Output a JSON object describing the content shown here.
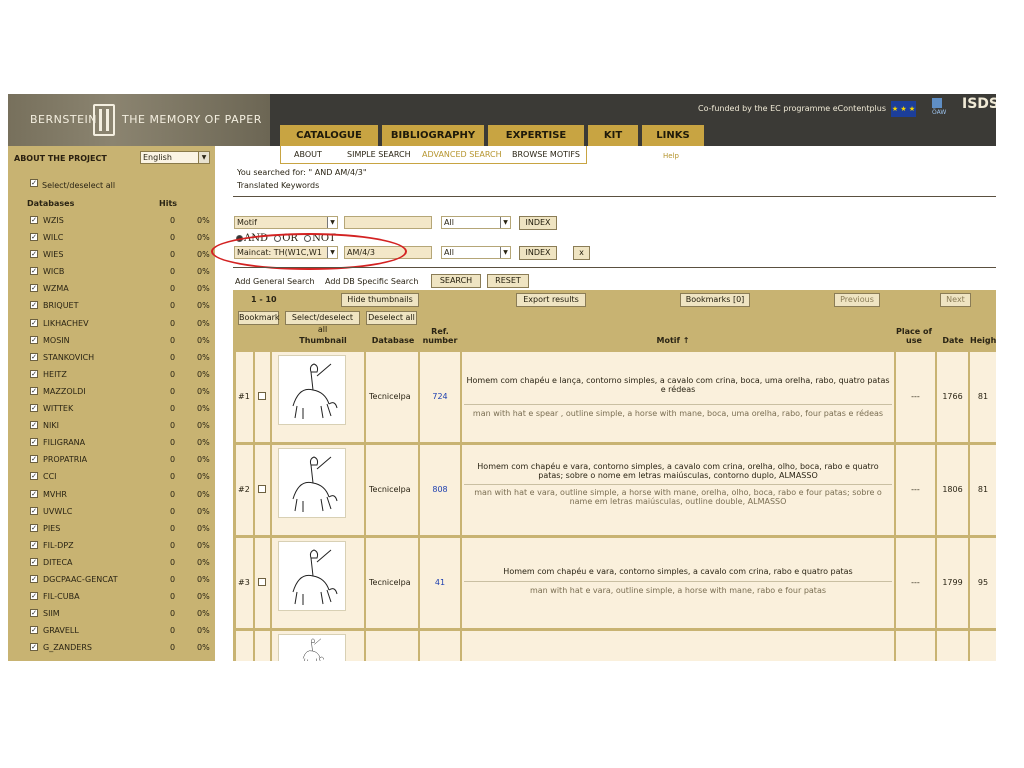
{
  "header": {
    "brand_left": "BERNSTEIN",
    "brand_right": "THE MEMORY OF PAPER",
    "cofunded": "Co-funded by the EC programme eContentplus",
    "eu_flag": "★ ★ ★",
    "oeaw_label": "ÖAW",
    "isds_label": "ISDS"
  },
  "nav": {
    "tabs": [
      {
        "label": "CATALOGUE"
      },
      {
        "label": "BIBLIOGRAPHY"
      },
      {
        "label": "EXPERTISE"
      },
      {
        "label": "KIT"
      },
      {
        "label": "LINKS"
      }
    ],
    "subnav": [
      "ABOUT",
      "SIMPLE SEARCH",
      "ADVANCED SEARCH",
      "BROWSE MOTIFS"
    ],
    "help": "Help"
  },
  "sidebar": {
    "about": "ABOUT THE PROJECT",
    "language": "English",
    "select_all": "Select/deselect all",
    "col_databases": "Databases",
    "col_hits": "Hits",
    "databases": [
      {
        "name": "WZIS",
        "hits": "0",
        "pct": "0%"
      },
      {
        "name": "WILC",
        "hits": "0",
        "pct": "0%"
      },
      {
        "name": "WIES",
        "hits": "0",
        "pct": "0%"
      },
      {
        "name": "WICB",
        "hits": "0",
        "pct": "0%"
      },
      {
        "name": "WZMA",
        "hits": "0",
        "pct": "0%"
      },
      {
        "name": "BRIQUET",
        "hits": "0",
        "pct": "0%"
      },
      {
        "name": "LIKHACHEV",
        "hits": "0",
        "pct": "0%"
      },
      {
        "name": "MOSIN",
        "hits": "0",
        "pct": "0%"
      },
      {
        "name": "STANKOVICH",
        "hits": "0",
        "pct": "0%"
      },
      {
        "name": "HEITZ",
        "hits": "0",
        "pct": "0%"
      },
      {
        "name": "MAZZOLDI",
        "hits": "0",
        "pct": "0%"
      },
      {
        "name": "WITTEK",
        "hits": "0",
        "pct": "0%"
      },
      {
        "name": "NIKI",
        "hits": "0",
        "pct": "0%"
      },
      {
        "name": "FILIGRANA",
        "hits": "0",
        "pct": "0%"
      },
      {
        "name": "PROPATRIA",
        "hits": "0",
        "pct": "0%"
      },
      {
        "name": "CCI",
        "hits": "0",
        "pct": "0%"
      },
      {
        "name": "MVHR",
        "hits": "0",
        "pct": "0%"
      },
      {
        "name": "UVWLC",
        "hits": "0",
        "pct": "0%"
      },
      {
        "name": "PIES",
        "hits": "0",
        "pct": "0%"
      },
      {
        "name": "FIL-DPZ",
        "hits": "0",
        "pct": "0%"
      },
      {
        "name": "DITECA",
        "hits": "0",
        "pct": "0%"
      },
      {
        "name": "DGCPAAC-GENCAT",
        "hits": "0",
        "pct": "0%"
      },
      {
        "name": "FIL-CUBA",
        "hits": "0",
        "pct": "0%"
      },
      {
        "name": "SIIM",
        "hits": "0",
        "pct": "0%"
      },
      {
        "name": "GRAVELL",
        "hits": "0",
        "pct": "0%"
      },
      {
        "name": "G_ZANDERS",
        "hits": "0",
        "pct": "0%"
      }
    ]
  },
  "search": {
    "searched_for": "You searched for: \" AND AM/4/3\"",
    "translated": "Translated Keywords",
    "row1": {
      "field": "Motif",
      "value": "",
      "mode": "All",
      "index_btn": "INDEX"
    },
    "radios": [
      "AND",
      "OR",
      "NOT"
    ],
    "row2": {
      "field": "Maincat: TH(W1C,W1",
      "value": "AM/4/3",
      "mode": "All",
      "index_btn": "INDEX",
      "remove_btn": "x"
    },
    "add_general": "Add General Search",
    "add_db": "Add DB Specific Search",
    "search_btn": "SEARCH",
    "reset_btn": "RESET"
  },
  "results": {
    "count": "1 - 10",
    "hide_thumbnails": "Hide thumbnails",
    "export": "Export results",
    "bookmarks": "Bookmarks [0]",
    "previous": "Previous",
    "next": "Next",
    "bookmark": "Bookmark",
    "select_all": "Select/deselect all",
    "deselect_all": "Deselect all",
    "columns": {
      "thumbnail": "Thumbnail",
      "database": "Database",
      "ref": "Ref. number",
      "motif": "Motif ↑",
      "place": "Place of use",
      "date": "Date",
      "height": "Height"
    },
    "rows": [
      {
        "num": "#1",
        "database": "Tecnicelpa",
        "ref": "724",
        "motif_pt": "Homem com chapéu e lança, contorno simples, a cavalo com crina, boca, uma orelha, rabo, quatro patas e rédeas",
        "motif_en": "man with hat e spear , outline simple, a horse with mane, boca, uma orelha, rabo, four patas e rédeas",
        "place": "---",
        "date": "1766",
        "height": "81"
      },
      {
        "num": "#2",
        "database": "Tecnicelpa",
        "ref": "808",
        "motif_pt": "Homem com chapéu e vara, contorno simples, a cavalo com crina, orelha, olho, boca, rabo e quatro patas; sobre o nome em letras maiúsculas, contorno duplo, ALMASSO",
        "motif_en": "man with hat e vara, outline simple, a horse with mane, orelha, olho, boca, rabo e four patas; sobre o name em letras maiúsculas, outline double, ALMASSO",
        "place": "---",
        "date": "1806",
        "height": "81"
      },
      {
        "num": "#3",
        "database": "Tecnicelpa",
        "ref": "41",
        "motif_pt": "Homem com chapéu e vara, contorno simples, a cavalo com crina, rabo e quatro patas",
        "motif_en": "man with hat e vara, outline simple, a horse with mane, rabo e four patas",
        "place": "---",
        "date": "1799",
        "height": "95"
      },
      {
        "num": "",
        "database": "",
        "ref": "",
        "motif_pt": "",
        "motif_en": "",
        "place": "",
        "date": "",
        "height": ""
      }
    ]
  },
  "colors": {
    "sidebar_bg": "#c8b372",
    "header_bg": "#3b3a36",
    "nav_tab": "#c8a442",
    "row_bg": "#faf0dc",
    "annotation": "#d32222",
    "ref_link": "#1d3fb0"
  }
}
